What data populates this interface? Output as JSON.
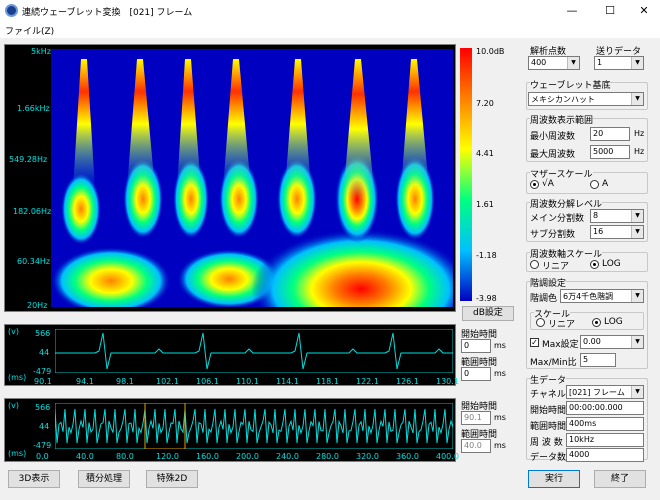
{
  "window": {
    "title": "連続ウェーブレット変換　[021] フレーム",
    "minimize": "—",
    "maximize": "☐",
    "close": "✕"
  },
  "menu": {
    "file": "ファイル(Z)"
  },
  "scalogram": {
    "freq_labels": [
      "5kHz",
      "1.66kHz",
      "549.28Hz",
      "182.06Hz",
      "60.34Hz",
      "20Hz"
    ],
    "colorbar_labels": [
      "10.0dB",
      "7.20",
      "4.41",
      "1.61",
      "-1.18",
      "-3.98"
    ],
    "colors": [
      "#0000c0",
      "#00c0ff",
      "#00ff80",
      "#ffff00",
      "#ff8000",
      "#ff0000"
    ],
    "db_button": "dB設定"
  },
  "waveform1": {
    "unit": "(v)",
    "unit_ms": "(ms)",
    "y_labels": [
      "566",
      "44",
      "-479"
    ],
    "x_labels": [
      "90.1",
      "94.1",
      "98.1",
      "102.1",
      "106.1",
      "110.1",
      "114.1",
      "118.1",
      "122.1",
      "126.1",
      "130.1"
    ],
    "start_label": "開始時間",
    "start_value": "0",
    "start_unit": "ms",
    "range_label": "範囲時間",
    "range_value": "0",
    "range_unit": "ms"
  },
  "waveform2": {
    "unit": "(v)",
    "unit_ms": "(ms)",
    "y_labels": [
      "566",
      "44",
      "-479"
    ],
    "x_labels": [
      "0.0",
      "40.0",
      "80.0",
      "120.0",
      "160.0",
      "200.0",
      "240.0",
      "280.0",
      "320.0",
      "360.0",
      "400.0"
    ],
    "start_label": "開始時間",
    "start_value": "90.1",
    "start_unit": "ms",
    "range_label": "範囲時間",
    "range_value": "40.0",
    "range_unit": "ms"
  },
  "right": {
    "analysis_points_label": "解析点数",
    "analysis_points": "400",
    "step_label": "送りデータ",
    "step_value": "1",
    "wavelet_label": "ウェーブレット基底",
    "wavelet_value": "メキシカンハット",
    "freq_range_label": "周波数表示範囲",
    "min_freq_label": "最小周波数",
    "min_freq": "20",
    "max_freq_label": "最大周波数",
    "max_freq": "5000",
    "hz": "Hz",
    "mother_scale_label": "マザースケール",
    "mother_opt1": "√A",
    "mother_opt2": "A",
    "freq_res_label": "周波数分解レベル",
    "main_div_label": "メイン分割数",
    "main_div": "8",
    "sub_div_label": "サブ分割数",
    "sub_div": "16",
    "freq_axis_label": "周波数軸スケール",
    "linear": "リニア",
    "log": "LOG",
    "gradation_label": "階調設定",
    "gradation_color_label": "階調色",
    "gradation_color": "6万4千色階調",
    "scale_label": "スケール",
    "max_label": "Max設定",
    "max_value": "0.00",
    "maxmin_label": "Max/Min比",
    "maxmin_value": "5",
    "raw_label": "生データ",
    "channel_label": "チャネル",
    "channel_value": "[021] フレーム",
    "start_time_label": "開始時間",
    "start_time": "00:00:00.000",
    "range_time_label": "範囲時間",
    "range_time": "400ms",
    "sampling_label": "周 波 数",
    "sampling": "10kHz",
    "data_count_label": "データ数",
    "data_count": "4000"
  },
  "buttons": {
    "display3d": "3D表示",
    "integrate": "積分処理",
    "special2d": "特殊2D",
    "run": "実行",
    "exit": "終了"
  }
}
